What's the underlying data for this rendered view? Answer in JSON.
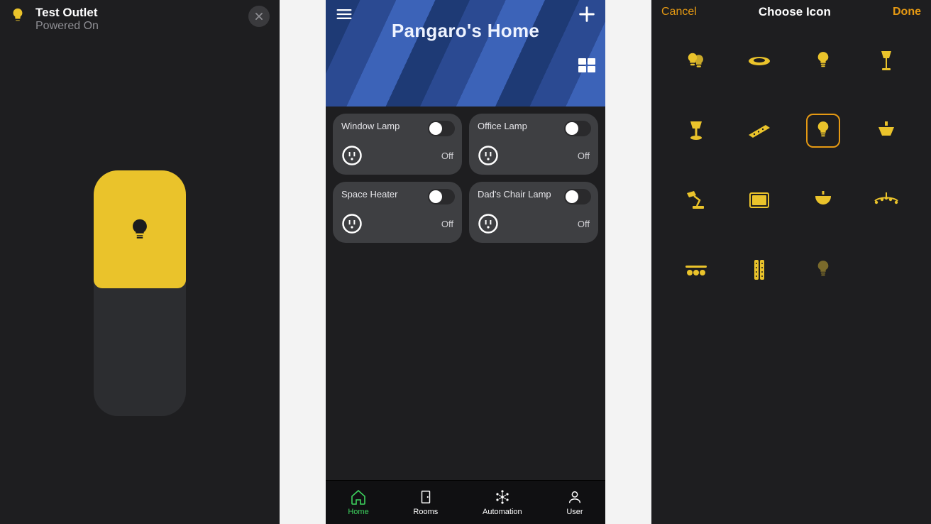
{
  "accent_yellow": "#eac32b",
  "accent_amber": "#e59913",
  "accent_green": "#3dd25e",
  "screen1": {
    "device_name": "Test Outlet",
    "status": "Powered On"
  },
  "screen2": {
    "home_name": "Pangaro's Home",
    "tiles": [
      {
        "name": "Window Lamp",
        "state": "Off",
        "on": false
      },
      {
        "name": "Office Lamp",
        "state": "Off",
        "on": false
      },
      {
        "name": "Space Heater",
        "state": "Off",
        "on": false
      },
      {
        "name": "Dad's Chair Lamp",
        "state": "Off",
        "on": false
      }
    ],
    "tabs": [
      {
        "label": "Home",
        "active": true
      },
      {
        "label": "Rooms",
        "active": false
      },
      {
        "label": "Automation",
        "active": false
      },
      {
        "label": "User",
        "active": false
      }
    ]
  },
  "screen3": {
    "cancel": "Cancel",
    "title": "Choose Icon",
    "done": "Done",
    "icons": [
      {
        "name": "bulb-pair-icon"
      },
      {
        "name": "disc-light-icon"
      },
      {
        "name": "bulb-icon"
      },
      {
        "name": "floor-lamp-icon"
      },
      {
        "name": "table-lamp-icon"
      },
      {
        "name": "light-strip-icon"
      },
      {
        "name": "bulb-outline-icon",
        "selected": true
      },
      {
        "name": "ceiling-round-icon"
      },
      {
        "name": "desk-lamp-icon"
      },
      {
        "name": "light-panel-icon"
      },
      {
        "name": "pendant-icon"
      },
      {
        "name": "chandelier-icon"
      },
      {
        "name": "track-lights-icon"
      },
      {
        "name": "light-bar-icon"
      },
      {
        "name": "bulb-dim-icon",
        "dim": true
      }
    ]
  }
}
